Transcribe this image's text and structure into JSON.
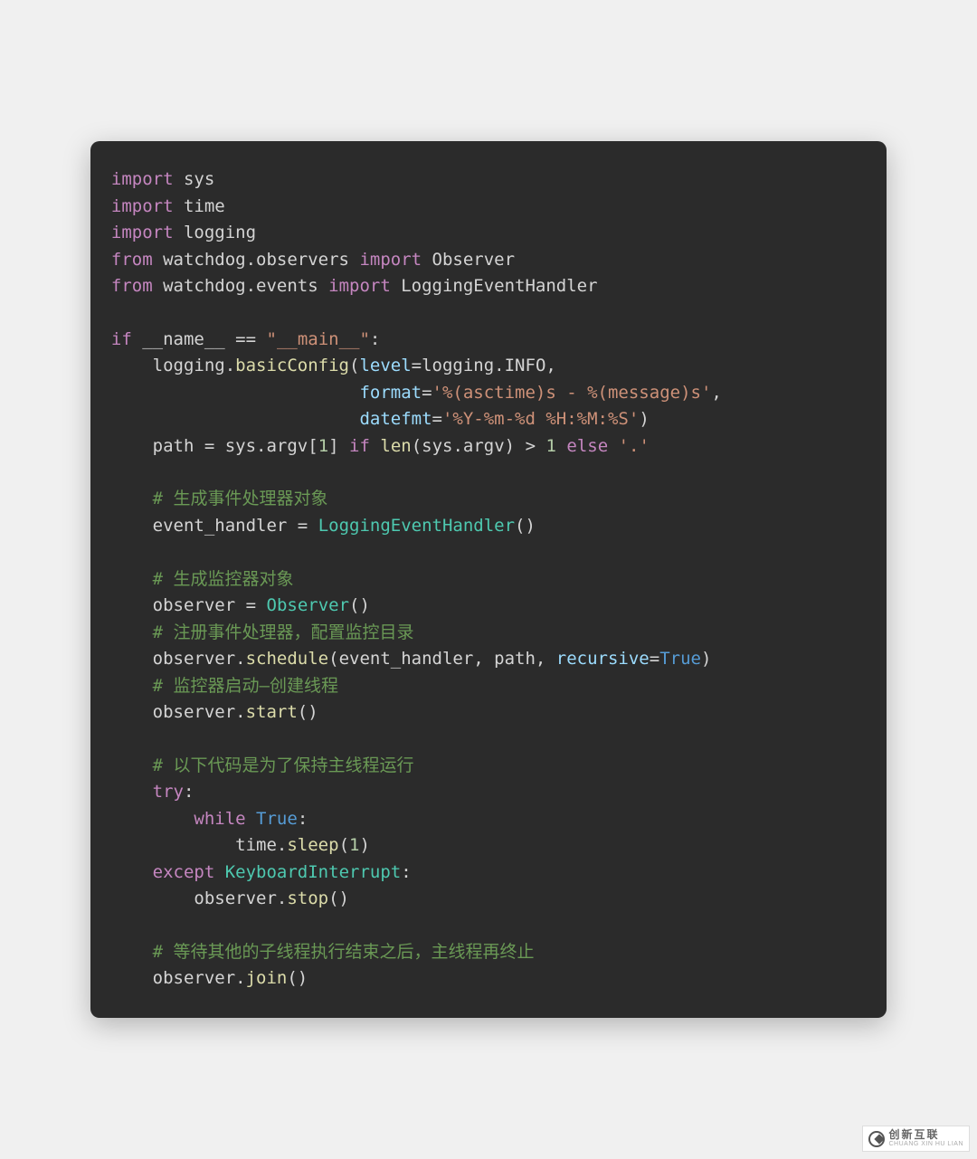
{
  "code": {
    "lines": [
      {
        "indent": 0,
        "tokens": [
          [
            "kw",
            "import"
          ],
          [
            "id",
            " sys"
          ]
        ]
      },
      {
        "indent": 0,
        "tokens": [
          [
            "kw",
            "import"
          ],
          [
            "id",
            " time"
          ]
        ]
      },
      {
        "indent": 0,
        "tokens": [
          [
            "kw",
            "import"
          ],
          [
            "id",
            " logging"
          ]
        ]
      },
      {
        "indent": 0,
        "tokens": [
          [
            "kw",
            "from"
          ],
          [
            "id",
            " watchdog.observers "
          ],
          [
            "kw",
            "import"
          ],
          [
            "id",
            " Observer"
          ]
        ]
      },
      {
        "indent": 0,
        "tokens": [
          [
            "kw",
            "from"
          ],
          [
            "id",
            " watchdog.events "
          ],
          [
            "kw",
            "import"
          ],
          [
            "id",
            " LoggingEventHandler"
          ]
        ]
      },
      {
        "indent": 0,
        "tokens": []
      },
      {
        "indent": 0,
        "tokens": [
          [
            "kw",
            "if"
          ],
          [
            "id",
            " __name__ "
          ],
          [
            "op",
            "=="
          ],
          [
            "id",
            " "
          ],
          [
            "str",
            "\"__main__\""
          ],
          [
            "op",
            ":"
          ]
        ]
      },
      {
        "indent": 1,
        "tokens": [
          [
            "id",
            "logging."
          ],
          [
            "fn",
            "basicConfig"
          ],
          [
            "op",
            "("
          ],
          [
            "cyan",
            "level"
          ],
          [
            "op",
            "="
          ],
          [
            "id",
            "logging.INFO,"
          ]
        ]
      },
      {
        "indent": 0,
        "tokens": [
          [
            "id",
            "                        "
          ],
          [
            "cyan",
            "format"
          ],
          [
            "op",
            "="
          ],
          [
            "str",
            "'%(asctime)s - %(message)s'"
          ],
          [
            "op",
            ","
          ]
        ]
      },
      {
        "indent": 0,
        "tokens": [
          [
            "id",
            "                        "
          ],
          [
            "cyan",
            "datefmt"
          ],
          [
            "op",
            "="
          ],
          [
            "str",
            "'%Y-%m-%d %H:%M:%S'"
          ],
          [
            "op",
            ")"
          ]
        ]
      },
      {
        "indent": 1,
        "tokens": [
          [
            "id",
            "path "
          ],
          [
            "op",
            "="
          ],
          [
            "id",
            " sys.argv["
          ],
          [
            "num",
            "1"
          ],
          [
            "id",
            "] "
          ],
          [
            "kw",
            "if"
          ],
          [
            "id",
            " "
          ],
          [
            "fn",
            "len"
          ],
          [
            "op",
            "("
          ],
          [
            "id",
            "sys.argv"
          ],
          [
            "op",
            ")"
          ],
          [
            "id",
            " "
          ],
          [
            "op",
            ">"
          ],
          [
            "id",
            " "
          ],
          [
            "num",
            "1"
          ],
          [
            "id",
            " "
          ],
          [
            "kw",
            "else"
          ],
          [
            "id",
            " "
          ],
          [
            "str",
            "'.'"
          ]
        ]
      },
      {
        "indent": 0,
        "tokens": []
      },
      {
        "indent": 1,
        "tokens": [
          [
            "cm",
            "# 生成事件处理器对象"
          ]
        ]
      },
      {
        "indent": 1,
        "tokens": [
          [
            "id",
            "event_handler "
          ],
          [
            "op",
            "="
          ],
          [
            "id",
            " "
          ],
          [
            "teal",
            "LoggingEventHandler"
          ],
          [
            "op",
            "()"
          ]
        ]
      },
      {
        "indent": 0,
        "tokens": []
      },
      {
        "indent": 1,
        "tokens": [
          [
            "cm",
            "# 生成监控器对象"
          ]
        ]
      },
      {
        "indent": 1,
        "tokens": [
          [
            "id",
            "observer "
          ],
          [
            "op",
            "="
          ],
          [
            "id",
            " "
          ],
          [
            "teal",
            "Observer"
          ],
          [
            "op",
            "()"
          ]
        ]
      },
      {
        "indent": 1,
        "tokens": [
          [
            "cm",
            "# 注册事件处理器，配置监控目录"
          ]
        ]
      },
      {
        "indent": 1,
        "tokens": [
          [
            "id",
            "observer."
          ],
          [
            "fn",
            "schedule"
          ],
          [
            "op",
            "("
          ],
          [
            "id",
            "event_handler, path, "
          ],
          [
            "cyan",
            "recursive"
          ],
          [
            "op",
            "="
          ],
          [
            "blue",
            "True"
          ],
          [
            "op",
            ")"
          ]
        ]
      },
      {
        "indent": 1,
        "tokens": [
          [
            "cm",
            "# 监控器启动—创建线程"
          ]
        ]
      },
      {
        "indent": 1,
        "tokens": [
          [
            "id",
            "observer."
          ],
          [
            "fn",
            "start"
          ],
          [
            "op",
            "()"
          ]
        ]
      },
      {
        "indent": 0,
        "tokens": []
      },
      {
        "indent": 1,
        "tokens": [
          [
            "cm",
            "# 以下代码是为了保持主线程运行"
          ]
        ]
      },
      {
        "indent": 1,
        "tokens": [
          [
            "kw",
            "try"
          ],
          [
            "op",
            ":"
          ]
        ]
      },
      {
        "indent": 2,
        "tokens": [
          [
            "kw",
            "while"
          ],
          [
            "id",
            " "
          ],
          [
            "blue",
            "True"
          ],
          [
            "op",
            ":"
          ]
        ]
      },
      {
        "indent": 3,
        "tokens": [
          [
            "id",
            "time."
          ],
          [
            "fn",
            "sleep"
          ],
          [
            "op",
            "("
          ],
          [
            "num",
            "1"
          ],
          [
            "op",
            ")"
          ]
        ]
      },
      {
        "indent": 1,
        "tokens": [
          [
            "kw",
            "except"
          ],
          [
            "id",
            " "
          ],
          [
            "teal",
            "KeyboardInterrupt"
          ],
          [
            "op",
            ":"
          ]
        ]
      },
      {
        "indent": 2,
        "tokens": [
          [
            "id",
            "observer."
          ],
          [
            "fn",
            "stop"
          ],
          [
            "op",
            "()"
          ]
        ]
      },
      {
        "indent": 0,
        "tokens": []
      },
      {
        "indent": 1,
        "tokens": [
          [
            "cm",
            "# 等待其他的子线程执行结束之后，主线程再终止"
          ]
        ]
      },
      {
        "indent": 1,
        "tokens": [
          [
            "id",
            "observer."
          ],
          [
            "fn",
            "join"
          ],
          [
            "op",
            "()"
          ]
        ]
      }
    ],
    "indent_unit": "    "
  },
  "watermark": {
    "main": "创新互联",
    "sub": "CHUANG XIN HU LIAN"
  }
}
